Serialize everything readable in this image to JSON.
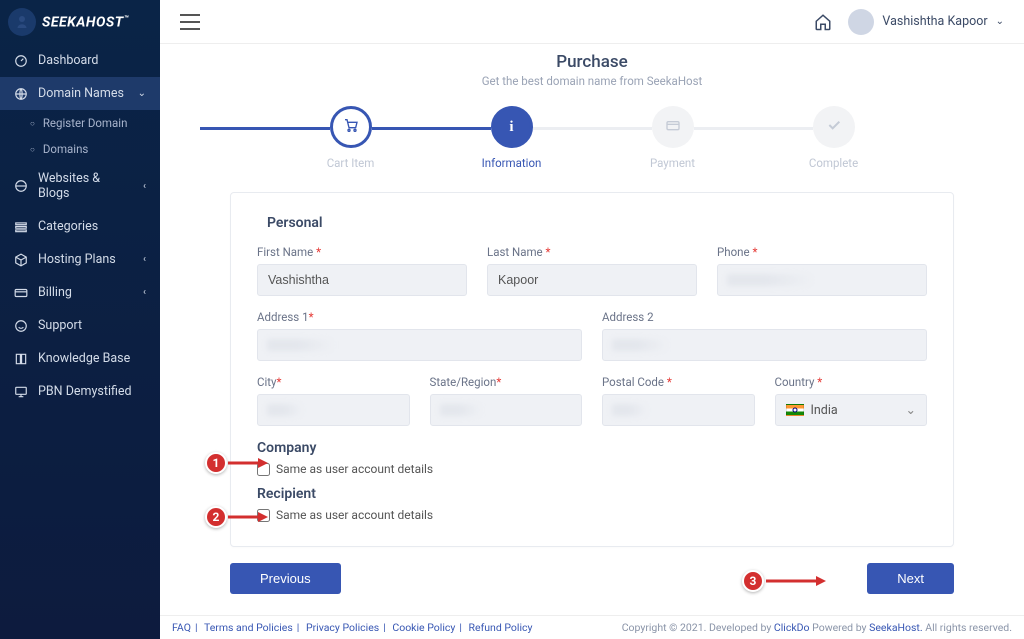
{
  "brand": {
    "name": "SEEKAHOST",
    "tm": "™"
  },
  "user": {
    "name": "Vashishtha Kapoor"
  },
  "sidebar": {
    "items": [
      {
        "label": "Dashboard",
        "icon": "gauge"
      },
      {
        "label": "Domain Names",
        "icon": "globe",
        "expandable": true,
        "active": true
      },
      {
        "label": "Websites & Blogs",
        "icon": "globe2",
        "expandable": true
      },
      {
        "label": "Categories",
        "icon": "list"
      },
      {
        "label": "Hosting Plans",
        "icon": "cube",
        "expandable": true
      },
      {
        "label": "Billing",
        "icon": "card",
        "expandable": true
      },
      {
        "label": "Support",
        "icon": "smile"
      },
      {
        "label": "Knowledge Base",
        "icon": "book"
      },
      {
        "label": "PBN Demystified",
        "icon": "monitor"
      }
    ],
    "subitems": [
      {
        "label": "Register Domain"
      },
      {
        "label": "Domains"
      }
    ]
  },
  "page": {
    "title": "Purchase",
    "subtitle": "Get the best domain name from SeekaHost"
  },
  "steps": [
    {
      "label": "Cart Item",
      "state": "done"
    },
    {
      "label": "Information",
      "state": "current"
    },
    {
      "label": "Payment",
      "state": "pending"
    },
    {
      "label": "Complete",
      "state": "pending"
    }
  ],
  "form": {
    "section_personal": "Personal",
    "section_company": "Company",
    "section_recipient": "Recipient",
    "same_as_user": "Same as user account details",
    "fields": {
      "first_name": {
        "label": "First Name",
        "required": true,
        "value": "Vashishtha"
      },
      "last_name": {
        "label": "Last Name",
        "required": true,
        "value": "Kapoor"
      },
      "phone": {
        "label": "Phone",
        "required": true,
        "value": ""
      },
      "address1": {
        "label": "Address 1",
        "required": true,
        "value": ""
      },
      "address2": {
        "label": "Address 2",
        "required": false,
        "value": ""
      },
      "city": {
        "label": "City",
        "required": true,
        "value": ""
      },
      "state": {
        "label": "State/Region",
        "required": true,
        "value": ""
      },
      "postal": {
        "label": "Postal Code",
        "required": true,
        "value": ""
      },
      "country": {
        "label": "Country",
        "required": true,
        "value": "India"
      }
    }
  },
  "buttons": {
    "previous": "Previous",
    "next": "Next"
  },
  "footer": {
    "links": [
      "FAQ",
      "Terms and Policies",
      "Privacy Policies",
      "Cookie Policy",
      "Refund Policy"
    ],
    "copyright_pre": "Copyright © 2021. Developed by ",
    "clickdo": "ClickDo",
    "powered": " Powered by ",
    "seekahost": "SeekaHost.",
    "rights": " All rights reserved."
  },
  "annotations": [
    "1",
    "2",
    "3"
  ]
}
